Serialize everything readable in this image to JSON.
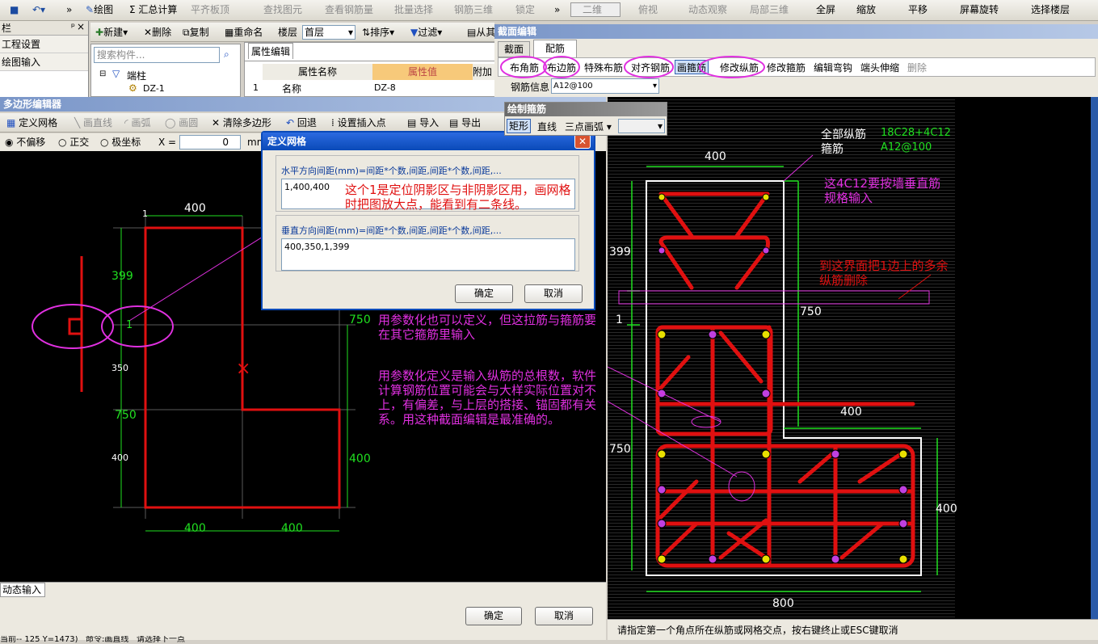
{
  "toolbar": {
    "items": [
      {
        "label": "绘图",
        "icon": "pencil-icon"
      },
      {
        "label": "Σ 汇总计算",
        "icon": "sum-icon"
      },
      {
        "label": "平齐板顶",
        "icon": "align-icon"
      },
      {
        "label": "查找图元",
        "icon": "find-icon"
      },
      {
        "label": "查看钢筋量",
        "icon": "view-icon"
      },
      {
        "label": "批量选择",
        "icon": "batch-icon"
      },
      {
        "label": "钢筋三维",
        "icon": "3d-icon"
      },
      {
        "label": "锁定",
        "icon": "lock-icon"
      },
      {
        "label": "二维",
        "icon": "2d-icon"
      },
      {
        "label": "俯视",
        "icon": "topview-icon"
      },
      {
        "label": "动态观察",
        "icon": "orbit-icon"
      },
      {
        "label": "局部三维",
        "icon": "local3d-icon"
      },
      {
        "label": "全屏",
        "icon": "fullscreen-icon"
      },
      {
        "label": "缩放",
        "icon": "zoom-icon"
      },
      {
        "label": "平移",
        "icon": "pan-icon"
      },
      {
        "label": "屏幕旋转",
        "icon": "rotate-icon"
      },
      {
        "label": "选择楼层",
        "icon": "floor-icon"
      }
    ]
  },
  "left_panel": {
    "title": "栏",
    "items": [
      "工程设置",
      "绘图输入"
    ]
  },
  "component": {
    "search_placeholder": "搜索构件...",
    "tree_root": "端柱",
    "tree_child": "DZ-1",
    "toolbar": [
      "新建",
      "删除",
      "复制",
      "重命名",
      "楼层",
      "首层",
      "排序",
      "过滤",
      "从其"
    ]
  },
  "props": {
    "tab": "属性编辑",
    "col_name": "属性名称",
    "col_value": "属性值",
    "col_extra": "附加",
    "row_num": "1",
    "row_name": "名称",
    "row_value": "DZ-8"
  },
  "poly_editor": {
    "title": "多边形编辑器",
    "tools": [
      "定义网格",
      "画直线",
      "画弧",
      "画圆",
      "清除多边形",
      "回退",
      "设置插入点",
      "导入",
      "导出"
    ],
    "mode": [
      "不偏移",
      "正交",
      "极坐标"
    ],
    "x_label": "X =",
    "x_value": "0",
    "unit": "mm",
    "dim_top": "400",
    "dim_bottom_a": "400",
    "dim_bottom_b": "400",
    "dim_left_a": "399",
    "dim_left_b": "1",
    "dim_left_c": "350",
    "dim_left_d": "750",
    "dim_left_e": "400",
    "dim_right_a": "750",
    "dim_right_b": "400",
    "tick_1": "1",
    "status_tab": "动态输入",
    "ok": "确定",
    "cancel": "取消"
  },
  "grid_dialog": {
    "title": "定义网格",
    "h_label": "水平方向间距(mm)=间距*个数,间距,间距*个数,间距,...",
    "h_value": "1,400,400",
    "v_label": "垂直方向间距(mm)=间距*个数,间距,间距*个数,间距,...",
    "v_value": "400,350,1,399",
    "ok": "确定",
    "cancel": "取消"
  },
  "section_editor": {
    "title": "截面编辑",
    "tabs": [
      "截面",
      "配筋"
    ],
    "tools": [
      "布角筋",
      "布边筋",
      "特殊布筋",
      "对齐钢筋",
      "画箍筋",
      "修改纵筋",
      "修改箍筋",
      "编辑弯钩",
      "端头伸缩",
      "删除"
    ],
    "rebar_label": "钢筋信息",
    "rebar_value": "A12@100",
    "draw_panel": {
      "title": "绘制箍筋",
      "tools": [
        "矩形",
        "直线",
        "三点画弧"
      ]
    },
    "legend_all": "全部纵筋",
    "legend_all_val": "18C28+4C12",
    "legend_stirrup": "箍筋",
    "legend_stirrup_val": "A12@100",
    "dim_400_top": "400",
    "dim_399": "399",
    "dim_1": "1",
    "dim_750_r": "750",
    "dim_400_mid": "400",
    "dim_750_l": "750",
    "dim_400_r": "400",
    "dim_800": "800",
    "status": "请指定第一个角点所在纵筋或网格交点，按右键终止或ESC键取消"
  },
  "annotations": {
    "note1": "这个1是定位阴影区与非阴影区用，画网格时把图放大点，能看到有二条线。",
    "note2": "用参数化也可以定义，但这拉筋与箍筋要在其它箍筋里输入",
    "note3": "用参数化定义是输入纵筋的总根数，软件计算钢筋位置可能会与大样实际位置对不上，有偏差，与上层的搭接、锚固都有关系。用这种截面编辑是最准确的。",
    "note4": "这4C12要按墙垂直筋规格输入",
    "note5": "到这界面把1边上的多余纵筋删除"
  },
  "bottom_status": [
    "当前-- 125 Y=1473)",
    "命令:画直线",
    "请选择下一点"
  ],
  "colors": {
    "red": "#e01010",
    "magenta": "#e030e0",
    "green": "#20e020",
    "title_blue": "#0a246a"
  }
}
